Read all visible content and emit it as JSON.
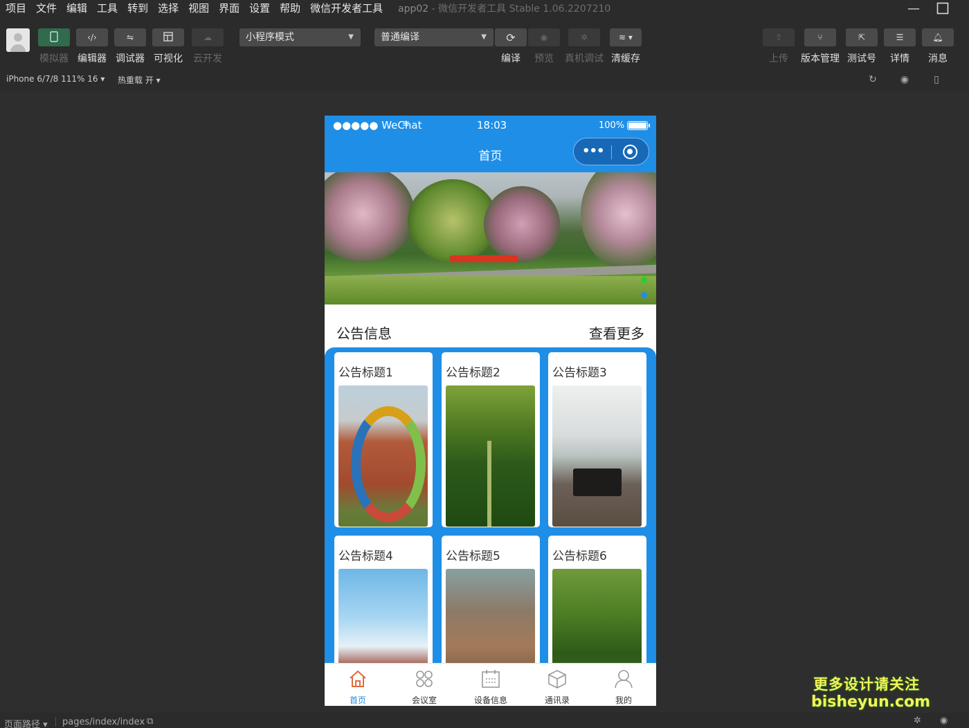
{
  "menu": [
    "项目",
    "文件",
    "编辑",
    "工具",
    "转到",
    "选择",
    "视图",
    "界面",
    "设置",
    "帮助",
    "微信开发者工具"
  ],
  "window": {
    "title": "app02",
    "subtitle": "- 微信开发者工具 Stable 1.06.2207210"
  },
  "toolbar": {
    "left_buttons": [
      {
        "label": "模拟器",
        "icon": "phone-icon",
        "active": true
      },
      {
        "label": "编辑器",
        "icon": "code-icon"
      },
      {
        "label": "调试器",
        "icon": "debug-icon"
      },
      {
        "label": "可视化",
        "icon": "layout-icon"
      },
      {
        "label": "云开发",
        "icon": "cloud-icon",
        "disabled": true
      }
    ],
    "mode_select": "小程序模式",
    "compile_select": "普通编译",
    "mid_buttons": [
      {
        "label": "编译",
        "icon": "refresh-icon"
      },
      {
        "label": "预览",
        "icon": "eye-icon",
        "disabled": true
      },
      {
        "label": "真机调试",
        "icon": "bug-icon",
        "disabled": true
      },
      {
        "label": "清缓存",
        "icon": "layers-icon"
      }
    ],
    "right_buttons": [
      {
        "label": "上传",
        "icon": "upload-icon",
        "disabled": true
      },
      {
        "label": "版本管理",
        "icon": "branch-icon"
      },
      {
        "label": "测试号",
        "icon": "external-icon"
      },
      {
        "label": "详情",
        "icon": "menu-icon"
      },
      {
        "label": "消息",
        "icon": "bell-icon"
      }
    ]
  },
  "devbar": {
    "device": "iPhone 6/7/8 111% 16 ▾",
    "hotreload": "热重载 开 ▾"
  },
  "phone": {
    "status": {
      "carrier": "●●●●● WeChat",
      "time": "18:03",
      "battery": "100%",
      "battery_level": 1.0
    },
    "nav_title": "首页",
    "banner_dots": 3,
    "notice_title": "公告信息",
    "notice_more": "查看更多",
    "cards": [
      {
        "title": "公告标题1"
      },
      {
        "title": "公告标题2"
      },
      {
        "title": "公告标题3"
      },
      {
        "title": "公告标题4"
      },
      {
        "title": "公告标题5"
      },
      {
        "title": "公告标题6"
      }
    ],
    "tabs": [
      {
        "label": "首页",
        "icon": "home-icon",
        "active": true
      },
      {
        "label": "会议室",
        "icon": "grid-icon"
      },
      {
        "label": "设备信息",
        "icon": "calendar-icon"
      },
      {
        "label": "通讯录",
        "icon": "box-icon"
      },
      {
        "label": "我的",
        "icon": "user-icon"
      }
    ]
  },
  "bottombar": {
    "path_label": "页面路径 ▾",
    "page_path": "pages/index/index"
  },
  "watermark": {
    "line1": "更多设计请关注",
    "line2": "bisheyun.com"
  },
  "colors": {
    "primary": "#1f8ee6",
    "active_tab": "#1f8ee6",
    "home_icon": "#e26a3a"
  }
}
